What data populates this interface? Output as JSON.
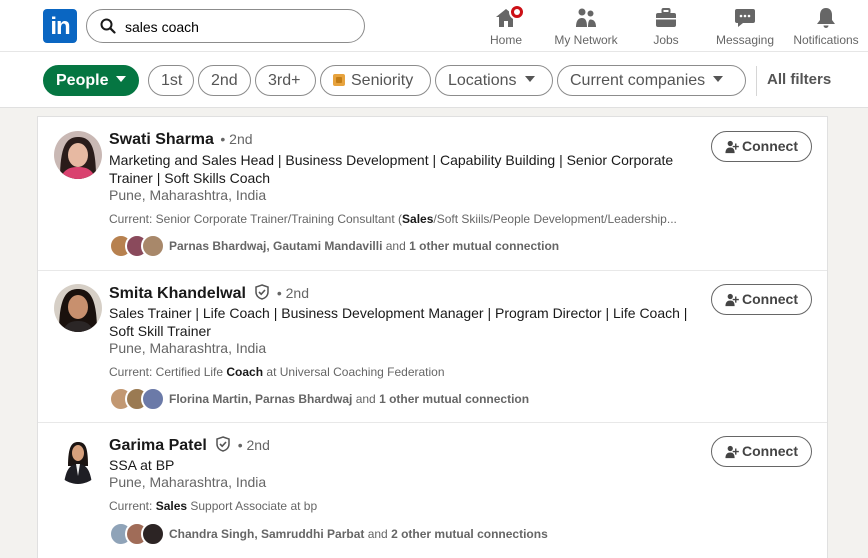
{
  "nav": {
    "logo_text": "in",
    "search_value": "sales coach",
    "items": [
      {
        "label": "Home",
        "icon": "home-icon"
      },
      {
        "label": "My Network",
        "icon": "people-icon"
      },
      {
        "label": "Jobs",
        "icon": "briefcase-icon"
      },
      {
        "label": "Messaging",
        "icon": "chat-icon"
      },
      {
        "label": "Notifications",
        "icon": "bell-icon"
      }
    ]
  },
  "filters": {
    "people": "People",
    "first": "1st",
    "second": "2nd",
    "third": "3rd+",
    "seniority": "Seniority",
    "locations": "Locations",
    "companies": "Current companies",
    "all_filters": "All filters"
  },
  "results": [
    {
      "name": "Swati Sharma",
      "degree": "• 2nd",
      "headline": "Marketing and Sales Head | Business Development | Capability Building | Senior Corporate Trainer | Soft Skills Coach",
      "location": "Pune, Maharashtra, India",
      "current_prefix": "Current: Senior Corporate Trainer/Training Consultant (",
      "current_bold": "Sales",
      "current_suffix": "/Soft Skiils/People Development/Leadership...",
      "mutual_names": "Parnas Bhardwaj, Gautami Mandavilli",
      "mutual_and": " and ",
      "mutual_other": "1 other mutual connection",
      "connect": "Connect"
    },
    {
      "name": "Smita Khandelwal",
      "degree": "• 2nd",
      "headline": "Sales Trainer | Life Coach  | Business Development Manager | Program Director | Life Coach | Soft Skill Trainer",
      "location": "Pune, Maharashtra, India",
      "current_prefix": "Current: Certified Life ",
      "current_bold": "Coach",
      "current_suffix": " at Universal Coaching Federation",
      "mutual_names": "Florina Martin, Parnas Bhardwaj",
      "mutual_and": " and ",
      "mutual_other": "1 other mutual connection",
      "connect": "Connect"
    },
    {
      "name": "Garima Patel",
      "degree": "• 2nd",
      "headline": "SSA at BP",
      "location": "Pune, Maharashtra, India",
      "current_prefix": "Current: ",
      "current_bold": "Sales",
      "current_suffix": " Support Associate at bp",
      "mutual_names": "Chandra Singh, Samruddhi Parbat",
      "mutual_and": " and ",
      "mutual_other": "2 other mutual connections",
      "connect": "Connect"
    }
  ],
  "colors": {
    "brand": "#0a66c2",
    "active_filter": "#057642",
    "notification": "#cc1016"
  }
}
